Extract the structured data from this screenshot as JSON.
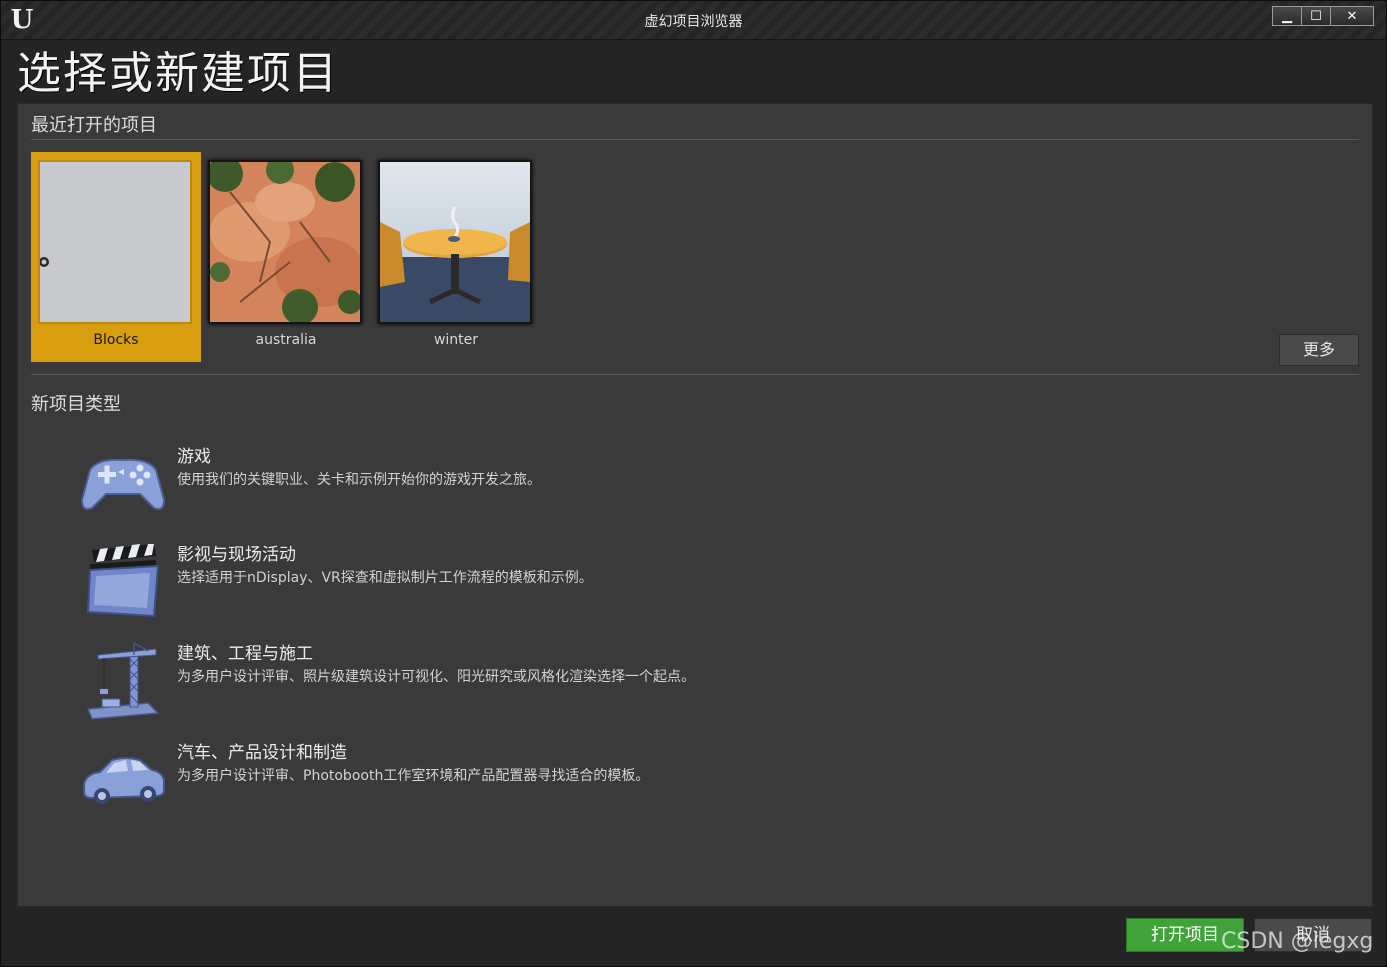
{
  "window": {
    "title": "虚幻项目浏览器",
    "logo_glyph": "U",
    "minimize_glyph": "▁",
    "maximize_glyph": "☐",
    "close_glyph": "✕"
  },
  "page_title": "选择或新建项目",
  "recent": {
    "title": "最近打开的项目",
    "projects": [
      {
        "name": "Blocks",
        "selected": true
      },
      {
        "name": "australia",
        "selected": false
      },
      {
        "name": "winter",
        "selected": false
      }
    ],
    "more_label": "更多"
  },
  "new_project": {
    "title": "新项目类型",
    "types": [
      {
        "name": "游戏",
        "description": "使用我们的关键职业、关卡和示例开始你的游戏开发之旅。",
        "icon": "gamepad-icon"
      },
      {
        "name": "影视与现场活动",
        "description": "选择适用于nDisplay、VR探查和虚拟制片工作流程的模板和示例。",
        "icon": "clapperboard-icon"
      },
      {
        "name": "建筑、工程与施工",
        "description": "为多用户设计评审、照片级建筑设计可视化、阳光研究或风格化渲染选择一个起点。",
        "icon": "crane-icon"
      },
      {
        "name": "汽车、产品设计和制造",
        "description": "为多用户设计评审、Photobooth工作室环境和产品配置器寻找适合的模板。",
        "icon": "car-icon"
      }
    ]
  },
  "footer": {
    "open_label": "打开项目",
    "cancel_label": "取消"
  },
  "watermark": "CSDN @legxg",
  "colors": {
    "selected_accent": "#d89e10",
    "open_button": "#3fa33a",
    "panel": "#3a3a3a",
    "background": "#242424"
  }
}
